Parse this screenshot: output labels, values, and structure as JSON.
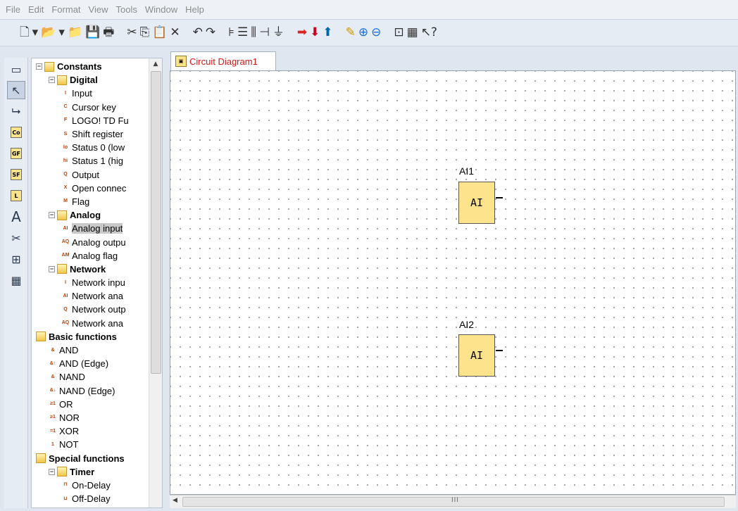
{
  "menu": [
    "File",
    "Edit",
    "Format",
    "View",
    "Tools",
    "Window",
    "Help"
  ],
  "toolbar_icons": [
    "new-file-icon",
    "dropdown-icon",
    "open-file-icon",
    "dropdown-icon",
    "open-folder-icon",
    "save-icon",
    "print-icon",
    "cut-icon",
    "copy-icon",
    "paste-icon",
    "delete-icon",
    "undo-icon",
    "redo-icon",
    "align-left-icon",
    "align-center-icon",
    "align-bottom-icon",
    "connector-icon",
    "ground-icon",
    "run-icon",
    "download-icon",
    "upload-icon",
    "pen-icon",
    "zoom-in-icon",
    "zoom-out-icon",
    "fit-icon",
    "block-icon",
    "help-cursor-icon"
  ],
  "sidebar_tools": [
    {
      "name": "select-all-icon",
      "glyph": "▭"
    },
    {
      "name": "pointer-icon",
      "glyph": "↖"
    },
    {
      "name": "connect-icon",
      "glyph": "⮡"
    },
    {
      "name": "co-icon",
      "glyph": "Co"
    },
    {
      "name": "gf-icon",
      "glyph": "GF"
    },
    {
      "name": "sf-icon",
      "glyph": "SF"
    },
    {
      "name": "l-icon",
      "glyph": "L"
    },
    {
      "name": "text-icon",
      "glyph": "A"
    },
    {
      "name": "cut-line-icon",
      "glyph": "✂"
    },
    {
      "name": "network-icon",
      "glyph": "⊞"
    },
    {
      "name": "computer-icon",
      "glyph": "▦"
    }
  ],
  "tree": [
    {
      "level": 0,
      "kind": "folder",
      "label": "Constants",
      "exp": "minus",
      "bold": true
    },
    {
      "level": 1,
      "kind": "folder",
      "label": "Digital",
      "exp": "minus",
      "bold": true
    },
    {
      "level": 2,
      "kind": "item",
      "icon": "I",
      "label": "Input"
    },
    {
      "level": 2,
      "kind": "item",
      "icon": "C",
      "label": "Cursor key"
    },
    {
      "level": 2,
      "kind": "item",
      "icon": "F",
      "label": "LOGO! TD Fu"
    },
    {
      "level": 2,
      "kind": "item",
      "icon": "S",
      "label": "Shift register"
    },
    {
      "level": 2,
      "kind": "item",
      "icon": "lo",
      "label": "Status 0 (low"
    },
    {
      "level": 2,
      "kind": "item",
      "icon": "hi",
      "label": "Status 1 (hig"
    },
    {
      "level": 2,
      "kind": "item",
      "icon": "Q",
      "label": "Output"
    },
    {
      "level": 2,
      "kind": "item",
      "icon": "X",
      "label": "Open connec"
    },
    {
      "level": 2,
      "kind": "item",
      "icon": "M",
      "label": "Flag"
    },
    {
      "level": 1,
      "kind": "folder",
      "label": "Analog",
      "exp": "minus",
      "bold": true
    },
    {
      "level": 2,
      "kind": "item",
      "icon": "AI",
      "label": "Analog input",
      "selected": true
    },
    {
      "level": 2,
      "kind": "item",
      "icon": "AQ",
      "label": "Analog outpu"
    },
    {
      "level": 2,
      "kind": "item",
      "icon": "AM",
      "label": "Analog flag"
    },
    {
      "level": 1,
      "kind": "folder",
      "label": "Network",
      "exp": "minus",
      "bold": true
    },
    {
      "level": 2,
      "kind": "item",
      "icon": "I",
      "label": "Network inpu"
    },
    {
      "level": 2,
      "kind": "item",
      "icon": "AI",
      "label": "Network ana"
    },
    {
      "level": 2,
      "kind": "item",
      "icon": "Q",
      "label": "Network outp"
    },
    {
      "level": 2,
      "kind": "item",
      "icon": "AQ",
      "label": "Network ana"
    },
    {
      "level": 0,
      "kind": "folder",
      "label": "Basic functions",
      "bold": true
    },
    {
      "level": 1,
      "kind": "item",
      "icon": "&",
      "label": "AND"
    },
    {
      "level": 1,
      "kind": "item",
      "icon": "&↑",
      "label": "AND (Edge)"
    },
    {
      "level": 1,
      "kind": "item",
      "icon": "&",
      "label": "NAND"
    },
    {
      "level": 1,
      "kind": "item",
      "icon": "&↓",
      "label": "NAND (Edge)"
    },
    {
      "level": 1,
      "kind": "item",
      "icon": "≥1",
      "label": "OR"
    },
    {
      "level": 1,
      "kind": "item",
      "icon": "≥1",
      "label": "NOR"
    },
    {
      "level": 1,
      "kind": "item",
      "icon": "=1",
      "label": "XOR"
    },
    {
      "level": 1,
      "kind": "item",
      "icon": "1",
      "label": "NOT"
    },
    {
      "level": 0,
      "kind": "folder",
      "label": "Special functions",
      "bold": true
    },
    {
      "level": 1,
      "kind": "folder",
      "label": "Timer",
      "exp": "minus",
      "bold": true
    },
    {
      "level": 2,
      "kind": "item",
      "icon": "⊓",
      "label": "On-Delay"
    },
    {
      "level": 2,
      "kind": "item",
      "icon": "⊔",
      "label": "Off-Delay"
    }
  ],
  "tab": {
    "label": "Circuit Diagram1"
  },
  "blocks": [
    {
      "name": "AI1",
      "label": "AI"
    },
    {
      "name": "AI2",
      "label": "AI"
    }
  ],
  "hscroll": {
    "grip": "III"
  }
}
